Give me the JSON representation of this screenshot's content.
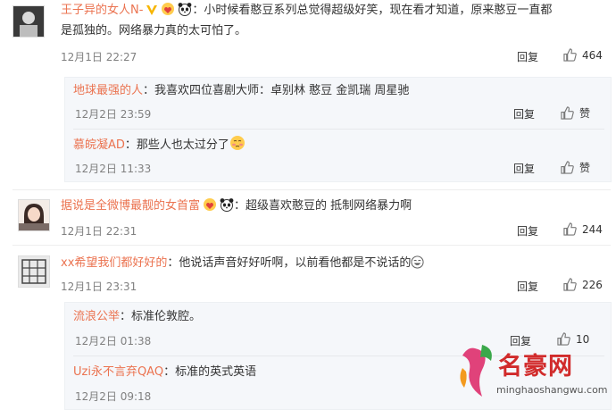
{
  "comments": [
    {
      "user": "王子异的女人N-",
      "text_line1": "：小时候看憨豆系列总觉得超级好笑，现在看才知道，原来憨豆一直都",
      "text_line2": "是孤独的。网络暴力真的太可怕了。",
      "time": "12月1日 22:27",
      "reply_label": "回复",
      "likes": "464"
    },
    {
      "user": "据说是全微博最靓的女首富",
      "text": "：超级喜欢憨豆的 抵制网络暴力啊",
      "time": "12月1日 22:31",
      "reply_label": "回复",
      "likes": "244"
    },
    {
      "user": "xx希望我们都好好的",
      "text": "：他说话声音好好听啊，以前看他都是不说话的",
      "time": "12月1日 23:31",
      "reply_label": "回复",
      "likes": "226"
    }
  ],
  "replies_a": [
    {
      "user": "地球最强的人",
      "text": "：我喜欢四位喜剧大师：卓别林 憨豆 金凯瑞 周星驰",
      "time": "12月2日 23:59",
      "reply_label": "回复",
      "like_label": "赞"
    },
    {
      "user": "慕皖凝AD",
      "text": "：那些人也太过分了",
      "time": "12月2日 11:33",
      "reply_label": "回复",
      "like_label": "赞"
    }
  ],
  "replies_b": [
    {
      "user": "流浪公举",
      "text": "：标准伦敦腔。",
      "time": "12月2日 01:38",
      "reply_label": "回复",
      "likes": "10"
    },
    {
      "user": "Uzi永不言弃QAQ",
      "text": "：标准的英式英语",
      "time": "12月2日 09:18"
    }
  ],
  "watermark": {
    "title": "名豪网",
    "url": "minghaoshangwu.com"
  },
  "colors": {
    "username": "#eb7350",
    "reply_bg": "#f5f7fa",
    "time": "#808080"
  }
}
